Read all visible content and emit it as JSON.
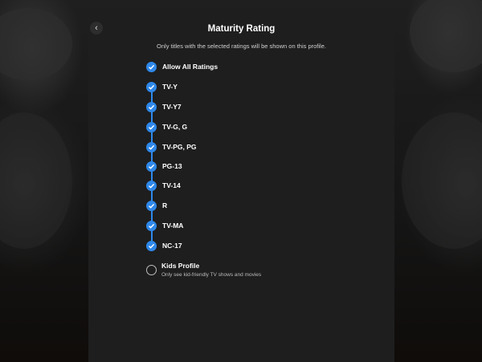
{
  "header": {
    "back_icon": "chevron-left-icon",
    "title": "Maturity Rating",
    "subtitle": "Only titles with the selected ratings will be shown on this profile."
  },
  "ratings": [
    {
      "label": "Allow All Ratings",
      "checked": true
    },
    {
      "label": "TV-Y",
      "checked": true
    },
    {
      "label": "TV-Y7",
      "checked": true
    },
    {
      "label": "TV-G, G",
      "checked": true
    },
    {
      "label": "TV-PG, PG",
      "checked": true
    },
    {
      "label": "PG-13",
      "checked": true
    },
    {
      "label": "TV-14",
      "checked": true
    },
    {
      "label": "R",
      "checked": true
    },
    {
      "label": "TV-MA",
      "checked": true
    },
    {
      "label": "NC-17",
      "checked": true
    }
  ],
  "kids_profile": {
    "label": "Kids Profile",
    "description": "Only see kid-friendly TV shows and movies",
    "checked": false
  },
  "colors": {
    "accent": "#2e88ea",
    "sheet": "#1e1e1e",
    "background": "#121212"
  }
}
